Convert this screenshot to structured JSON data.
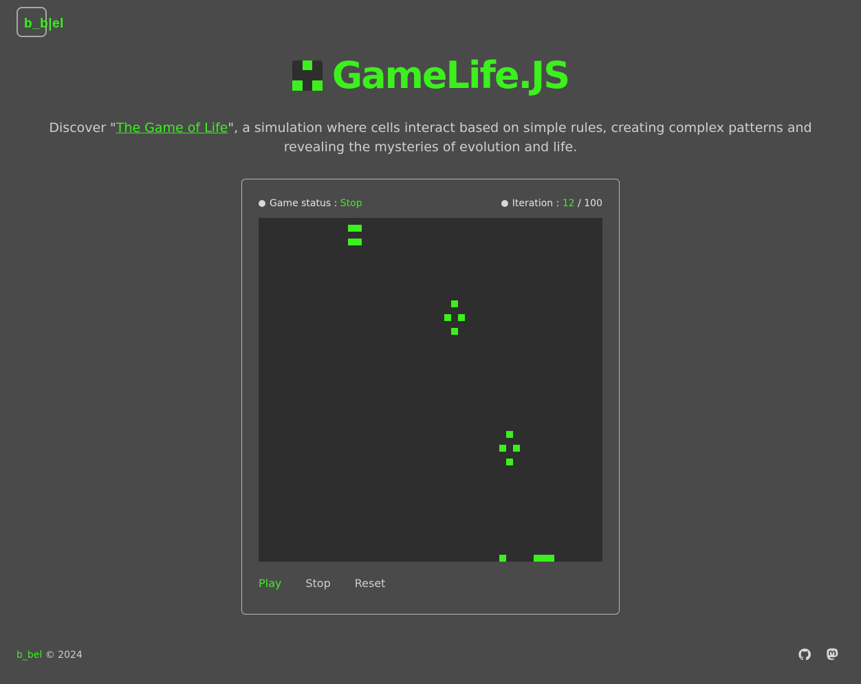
{
  "header": {
    "logo_text": "b_b|el",
    "title": "GameLife.JS",
    "title_icon": "checker-block-icon"
  },
  "intro": {
    "prefix": "Discover \"",
    "link_text": "The Game of Life",
    "suffix": "\", a simulation where cells interact based on simple rules, creating complex patterns and revealing the mysteries of evolution and life."
  },
  "game": {
    "status_label": "Game status :",
    "status_value": "Stop",
    "iteration_label": "Iteration :",
    "iteration_current": "12",
    "iteration_separator": "/",
    "iteration_max": "100",
    "grid": {
      "columns": 50,
      "rows": 50,
      "live_cells": [
        [
          13,
          1
        ],
        [
          14,
          1
        ],
        [
          13,
          3
        ],
        [
          14,
          3
        ],
        [
          28,
          12
        ],
        [
          27,
          14
        ],
        [
          29,
          14
        ],
        [
          28,
          16
        ],
        [
          36,
          31
        ],
        [
          35,
          33
        ],
        [
          37,
          33
        ],
        [
          36,
          35
        ],
        [
          35,
          49
        ],
        [
          40,
          49
        ],
        [
          41,
          49
        ],
        [
          42,
          49
        ]
      ]
    },
    "controls": {
      "play": "Play",
      "stop": "Stop",
      "reset": "Reset"
    }
  },
  "footer": {
    "brand": "b_bel",
    "copyright": "© 2024",
    "icons": [
      "github-icon",
      "mastodon-icon"
    ]
  },
  "colors": {
    "accent": "#3cf01e",
    "background": "#4a4a4a",
    "board": "#2e2e2e"
  }
}
